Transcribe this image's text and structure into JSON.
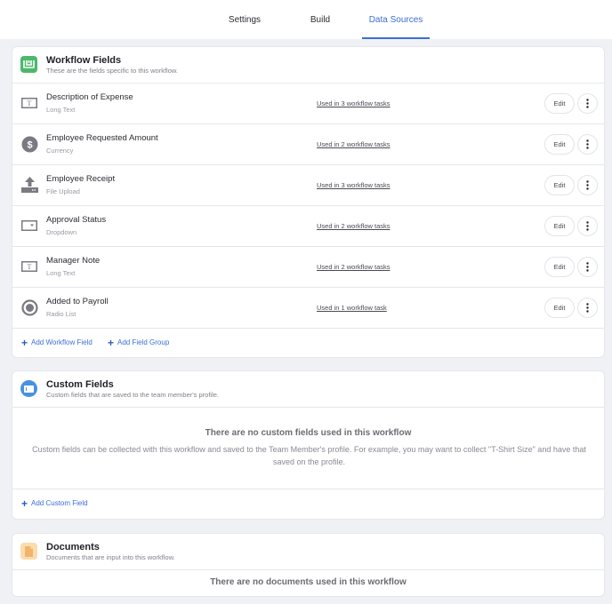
{
  "tabs": [
    {
      "label": "Settings",
      "active": false
    },
    {
      "label": "Build",
      "active": false
    },
    {
      "label": "Data Sources",
      "active": true
    }
  ],
  "colors": {
    "accent": "#3b6fd8",
    "workflow_icon_bg": "#4cb86b",
    "custom_icon_bg": "#4a90e2",
    "documents_icon_bg": "#fbdcae",
    "field_icon": "#7a7a82"
  },
  "workflow_fields": {
    "title": "Workflow Fields",
    "subtitle": "These are the fields specific to this workflow.",
    "icon": "workflow-icon",
    "rows": [
      {
        "name": "Description of Expense",
        "type": "Long Text",
        "icon": "long-text-icon",
        "usage": "Used in 3 workflow tasks",
        "edit": "Edit"
      },
      {
        "name": "Employee Requested Amount",
        "type": "Currency",
        "icon": "currency-icon",
        "usage": "Used in 2 workflow tasks",
        "edit": "Edit"
      },
      {
        "name": "Employee Receipt",
        "type": "File Upload",
        "icon": "file-upload-icon",
        "usage": "Used in 3 workflow tasks",
        "edit": "Edit"
      },
      {
        "name": "Approval Status",
        "type": "Dropdown",
        "icon": "dropdown-icon",
        "usage": "Used in 2 workflow tasks",
        "edit": "Edit"
      },
      {
        "name": "Manager Note",
        "type": "Long Text",
        "icon": "long-text-icon",
        "usage": "Used in 2 workflow tasks",
        "edit": "Edit"
      },
      {
        "name": "Added to Payroll",
        "type": "Radio List",
        "icon": "radio-list-icon",
        "usage": "Used in 1 workflow task",
        "edit": "Edit"
      }
    ],
    "add_field_label": "Add Workflow Field",
    "add_group_label": "Add Field Group"
  },
  "custom_fields": {
    "title": "Custom Fields",
    "subtitle": "Custom fields that are saved to the team member's profile.",
    "icon": "custom-field-icon",
    "empty_title": "There are no custom fields used in this workflow",
    "empty_desc": "Custom fields can be collected with this workflow and saved to the Team Member's profile. For example, you may want to collect \"T-Shirt Size\" and have that saved on the profile.",
    "add_label": "Add Custom Field"
  },
  "documents": {
    "title": "Documents",
    "subtitle": "Documents that are input into this workflow.",
    "icon": "document-icon",
    "empty_title": "There are no documents used in this workflow"
  }
}
